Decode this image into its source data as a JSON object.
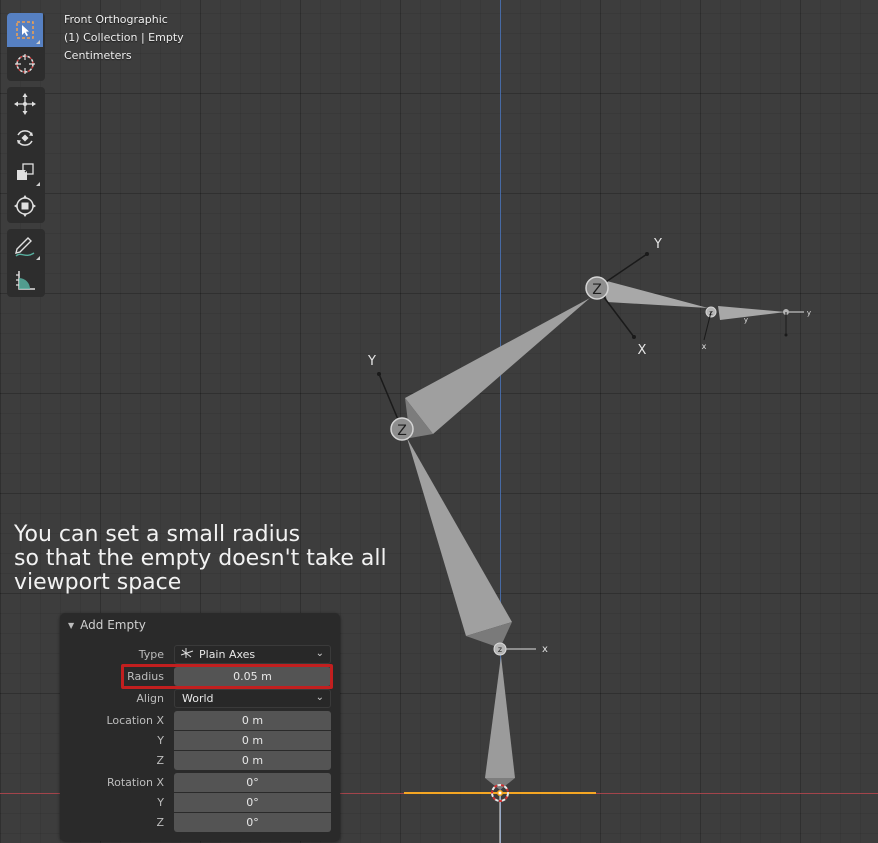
{
  "viewport": {
    "view_name": "Front Orthographic",
    "collection_info": "(1) Collection | Empty",
    "units": "Centimeters",
    "tip_text": "You can set a small radius\nso that the empty doesn't take all\nviewport space",
    "axis_labels": {
      "small_z": "z",
      "small_x": "x",
      "small_y": "y",
      "big_z": "Z",
      "big_y": "Y",
      "big_x": "X"
    },
    "colors": {
      "background": "#3d3d3d",
      "x_axis": "#b0474f",
      "y_axis": "#4b74b8",
      "bone": "#9b9b9b",
      "selection_orange": "#f5a623",
      "highlight_box": "#c21f1f"
    }
  },
  "toolbar": {
    "tools": [
      {
        "name": "select-box",
        "icon": "select-box-icon",
        "active": true
      },
      {
        "name": "cursor",
        "icon": "cursor-icon",
        "active": false
      },
      {
        "name": "move",
        "icon": "move-icon",
        "active": false
      },
      {
        "name": "rotate",
        "icon": "rotate-icon",
        "active": false
      },
      {
        "name": "scale",
        "icon": "scale-icon",
        "active": false
      },
      {
        "name": "transform",
        "icon": "transform-icon",
        "active": false
      },
      {
        "name": "annotate",
        "icon": "annotate-icon",
        "active": false
      },
      {
        "name": "measure",
        "icon": "measure-icon",
        "active": false
      }
    ]
  },
  "panel": {
    "title": "Add Empty",
    "type_label": "Type",
    "type_value": "Plain Axes",
    "radius_label": "Radius",
    "radius_value": "0.05 m",
    "align_label": "Align",
    "align_value": "World",
    "location_x_label": "Location X",
    "location_x_value": "0 m",
    "location_y_label": "Y",
    "location_y_value": "0 m",
    "location_z_label": "Z",
    "location_z_value": "0 m",
    "rotation_x_label": "Rotation X",
    "rotation_x_value": "0°",
    "rotation_y_label": "Y",
    "rotation_y_value": "0°",
    "rotation_z_label": "Z",
    "rotation_z_value": "0°"
  }
}
